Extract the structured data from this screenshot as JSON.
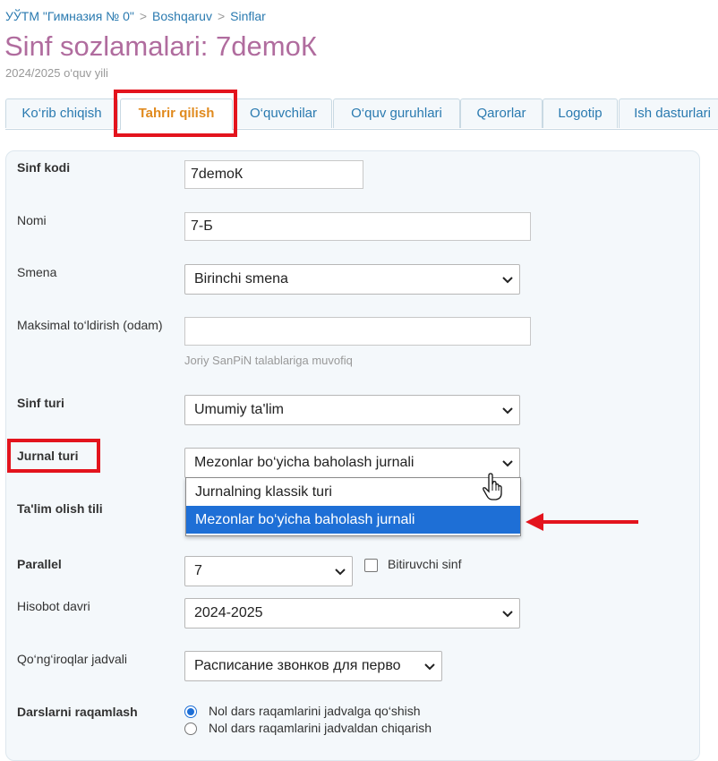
{
  "breadcrumb": {
    "items": [
      "УЎТМ \"Гимназия № 0\"",
      "Boshqaruv",
      "Sinflar"
    ],
    "separator": ">"
  },
  "page": {
    "title": "Sinf sozlamalari: 7demoК",
    "subtitle": "2024/2025 o‘quv yili"
  },
  "tabs": [
    "Ko‘rib chiqish",
    "Tahrir qilish",
    "O‘quvchilar",
    "O‘quv guruhlari",
    "Qarorlar",
    "Logotip",
    "Ish dasturlari"
  ],
  "active_tab": "Tahrir qilish",
  "form": {
    "sinf_kodi": {
      "label": "Sinf kodi",
      "value": "7demoК"
    },
    "nomi": {
      "label": "Nomi",
      "value": "7-Б"
    },
    "smena": {
      "label": "Smena",
      "value": "Birinchi smena"
    },
    "maks": {
      "label": "Maksimal to‘ldirish (odam)",
      "value": "",
      "hint": "Joriy SanPiN talablariga muvofiq"
    },
    "sinf_turi": {
      "label": "Sinf turi",
      "value": "Umumiy ta'lim"
    },
    "jurnal_turi": {
      "label": "Jurnal turi",
      "value": "Mezonlar bo‘yicha baholash jurnali",
      "options": [
        "Jurnalning klassik turi",
        "Mezonlar bo‘yicha baholash jurnali"
      ],
      "highlighted_option": 1
    },
    "talim_tili": {
      "label": "Ta'lim olish tili"
    },
    "parallel": {
      "label": "Parallel",
      "value": "7",
      "checkbox_label": "Bitiruvchi sinf",
      "checked": false
    },
    "hisobot": {
      "label": "Hisobot davri",
      "value": "2024-2025"
    },
    "qongiroqlar": {
      "label": "Qo‘ng‘iroqlar jadvali",
      "value": "Расписание звонков для перво"
    },
    "raqamlash": {
      "label": "Darslarni raqamlash",
      "options": [
        "Nol dars raqamlarini jadvalga qo‘shish",
        "Nol dars raqamlarini jadvaldan chiqarish"
      ],
      "selected": 0
    }
  },
  "colors": {
    "accent": "#2a7ab0",
    "title": "#b06c9e",
    "active_tab": "#e08a1e",
    "highlight": "#e3141d",
    "selection": "#1e6fd6"
  }
}
